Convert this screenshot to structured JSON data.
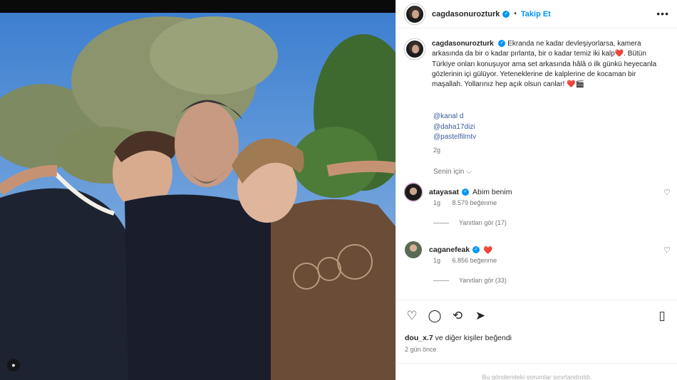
{
  "photo": {
    "alt": "Three people posing outdoors"
  },
  "post": {
    "username": "cagdasonurozturk",
    "verified_mark": "✓",
    "follow_label": "Takip Et",
    "more_icon": "more-horizontal-icon",
    "caption": "Ekranda ne kadar devleşiyorlarsa, kamera arkasında da bir o kadar pırlanta, bir o kadar temiz iki kalp❤️. Bütün Türkiye onları konuşuyor ama set arkasında hâlâ o ilk günkü heyecanla gözlerinin içi gülüyor. Yeteneklerine de kalplerine de kocaman bir maşallah. Yollarınız hep açık olsun canlar! ❤️🎬",
    "mentions": [
      "@kanal d",
      "@daha17dizi",
      "@pastelfilmtv"
    ],
    "time": "2g",
    "for_you": "Senin için ⌵"
  },
  "comments": [
    {
      "username": "atayasat",
      "verified": "✓",
      "text": "Abim benim",
      "time": "1g",
      "likes": "8.579 beğenme",
      "replies": "Yanıtları gör (17)"
    },
    {
      "username": "caganefeak",
      "verified": "✓",
      "text": "❤️",
      "time": "1g",
      "likes": "6.856 beğenme",
      "replies": "Yanıtları gör (33)"
    }
  ],
  "actions": {
    "like_icon": "heart-icon",
    "comment_icon": "comment-icon",
    "repost_icon": "repost-icon",
    "share_icon": "send-icon",
    "save_icon": "bookmark-icon",
    "liked_by_user": "dou_x.7",
    "liked_by_rest": "ve diğer kişiler beğendi",
    "ago": "2 gün önce",
    "restricted": "Bu gönderideki yorumlar sınırlandırıldı."
  }
}
